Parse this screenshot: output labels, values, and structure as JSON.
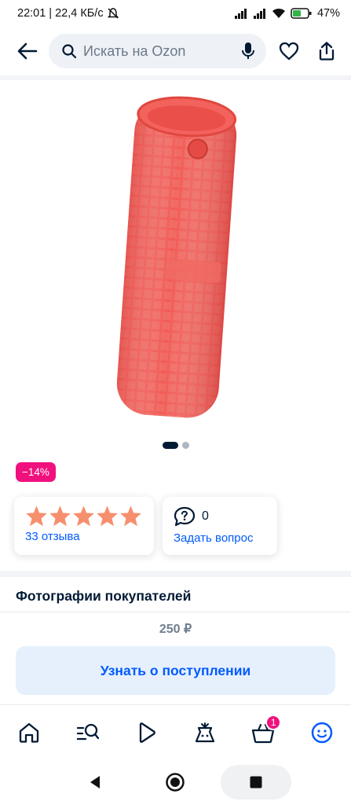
{
  "status_bar": {
    "time": "22:01",
    "network_speed": "22,4 КБ/с",
    "battery": "47%"
  },
  "header": {
    "search_placeholder": "Искать на Ozon"
  },
  "product": {
    "image_color": "#f05555",
    "discount": "−14%",
    "carousel": {
      "current": 1,
      "total": 2
    }
  },
  "rating": {
    "stars": 5,
    "reviews_label": "33 отзыва"
  },
  "questions": {
    "count": "0",
    "ask_label": "Задать вопрос"
  },
  "customer_photos_title": "Фотографии покупателей",
  "price": "250 ₽",
  "notify_button": "Узнать о поступлении",
  "bottom_nav": {
    "items": [
      "home-icon",
      "search-catalog-icon",
      "video-icon",
      "fresh-icon",
      "cart-icon",
      "profile-icon"
    ],
    "cart_badge": "1"
  },
  "colors": {
    "accent": "#005bff",
    "badge": "#f1117e",
    "star": "#f68f6e"
  }
}
